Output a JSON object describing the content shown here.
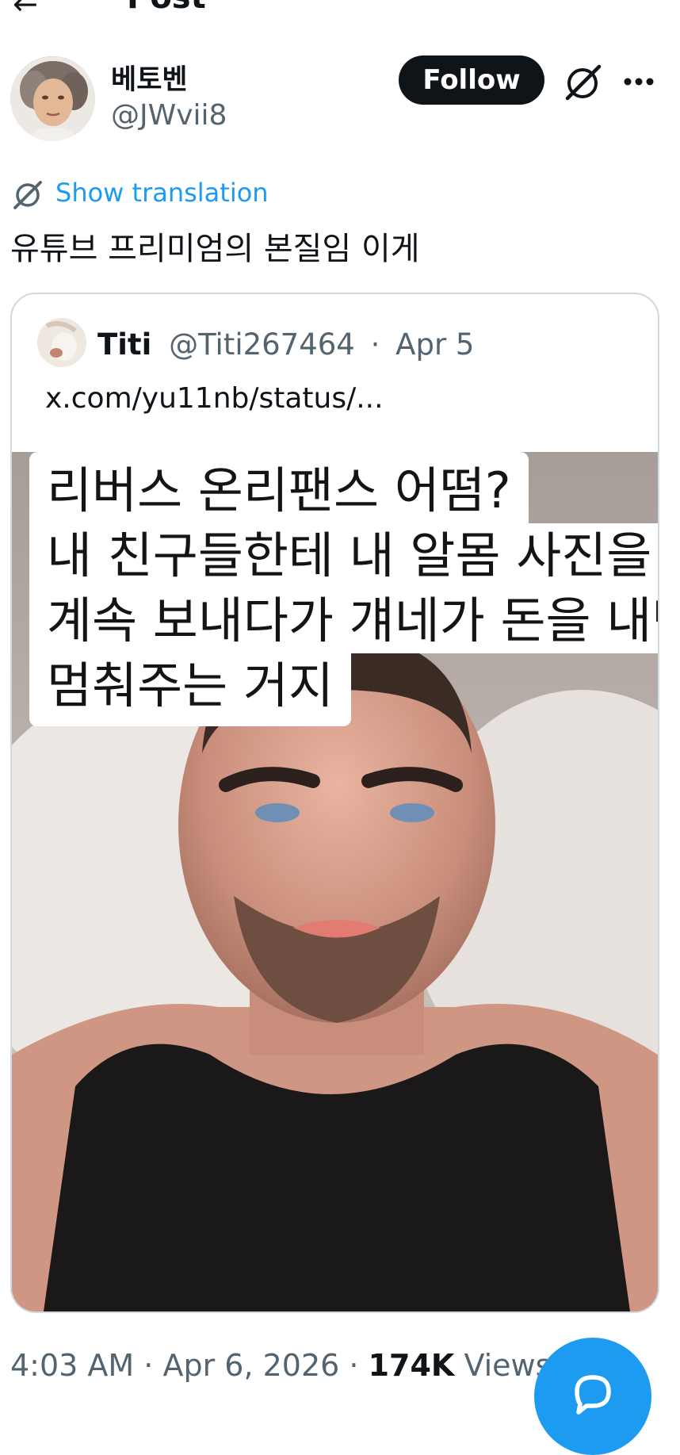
{
  "header": {
    "back_icon": "arrow-left-icon",
    "title": "Post"
  },
  "author": {
    "display_name": "베토벤",
    "handle": "@JWvii8",
    "follow_label": "Follow",
    "avatar_icon": "beethoven-portrait-avatar",
    "grok_icon": "grok-icon",
    "more_icon": "more-horizontal-icon"
  },
  "post": {
    "translate_icon": "grok-translate-icon",
    "show_translation": "Show translation",
    "text": "유튜브 프리미엄의 본질임 이게"
  },
  "quote": {
    "name": "Titi",
    "handle": "@Titi267464",
    "separator": "·",
    "date": "Apr 5",
    "link": "x.com/yu11nb/status/...",
    "media_text": [
      "리버스 온리팬스 어떰?",
      "내 친구들한테 내 알몸 사진을",
      "계속 보내다가 걔네가 돈을 내면",
      "멈춰주는 거지"
    ]
  },
  "meta": {
    "time": "4:03 AM",
    "sep1": " · ",
    "date": "Apr 6, 2026",
    "sep2": " · ",
    "views_count": "174K",
    "views_label": " Views"
  },
  "fab": {
    "icon": "reply-bubble-icon"
  },
  "colors": {
    "accent": "#1d9bf0",
    "text_primary": "#0f1419",
    "text_secondary": "#536471",
    "border": "#cfd9de"
  }
}
